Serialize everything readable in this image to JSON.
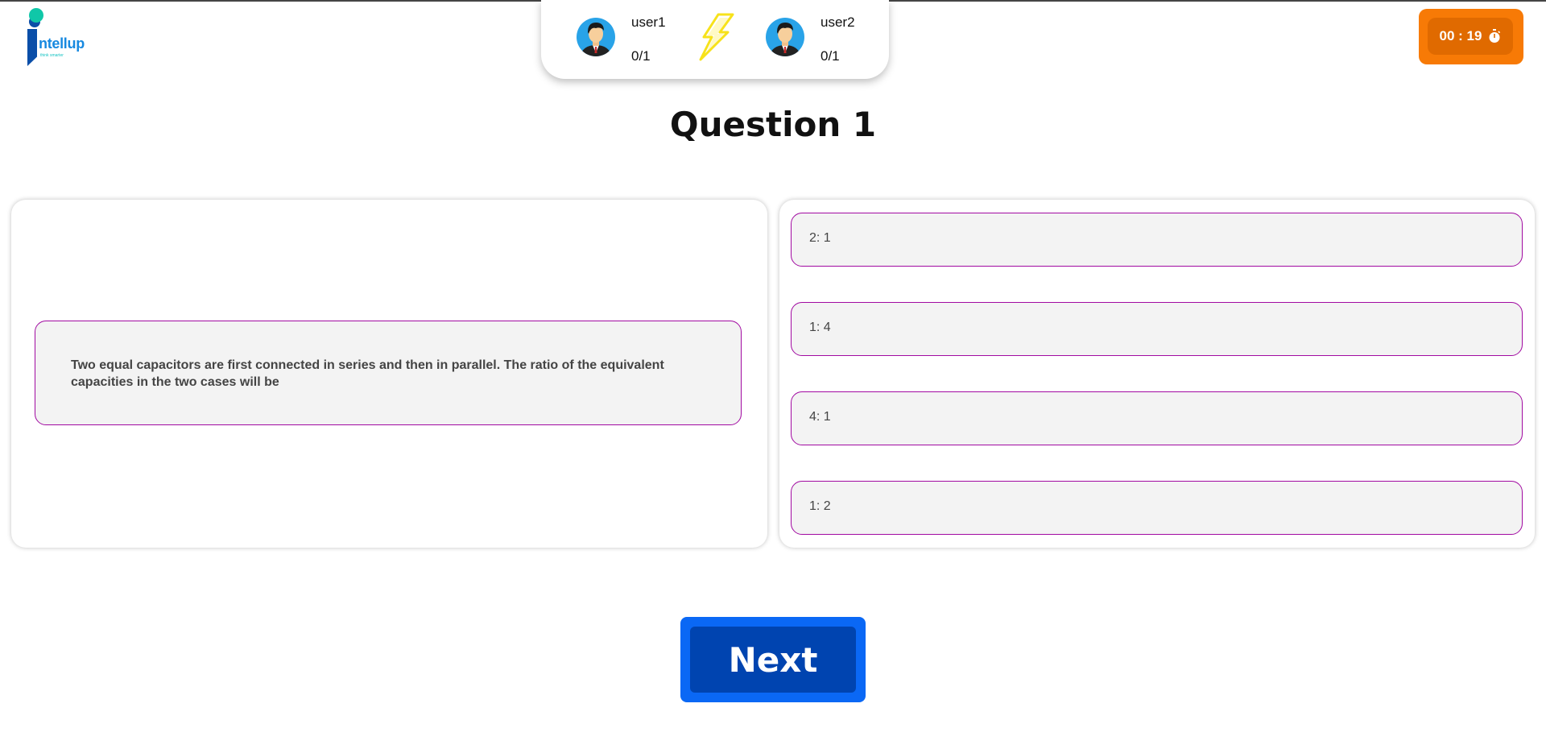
{
  "brand": {
    "name": "ntellup",
    "tagline": "think smarter"
  },
  "players": [
    {
      "name": "user1",
      "score": "0/1"
    },
    {
      "name": "user2",
      "score": "0/1"
    }
  ],
  "timer": {
    "value": "00 : 19",
    "icon": "stopwatch-icon"
  },
  "question": {
    "title": "Question 1",
    "text": "Two equal capacitors are first connected in series and then in parallel. The ratio of the equivalent capacities in the two cases will be"
  },
  "options": [
    "2: 1",
    "1: 4",
    "4: 1",
    "1: 2"
  ],
  "actions": {
    "next_label": "Next"
  },
  "colors": {
    "option_border": "#a10aa1",
    "timer_bg": "#f77a06",
    "next_bg": "#0a68f5",
    "next_inner": "#0044b0",
    "bolt": "#f7e21b"
  }
}
